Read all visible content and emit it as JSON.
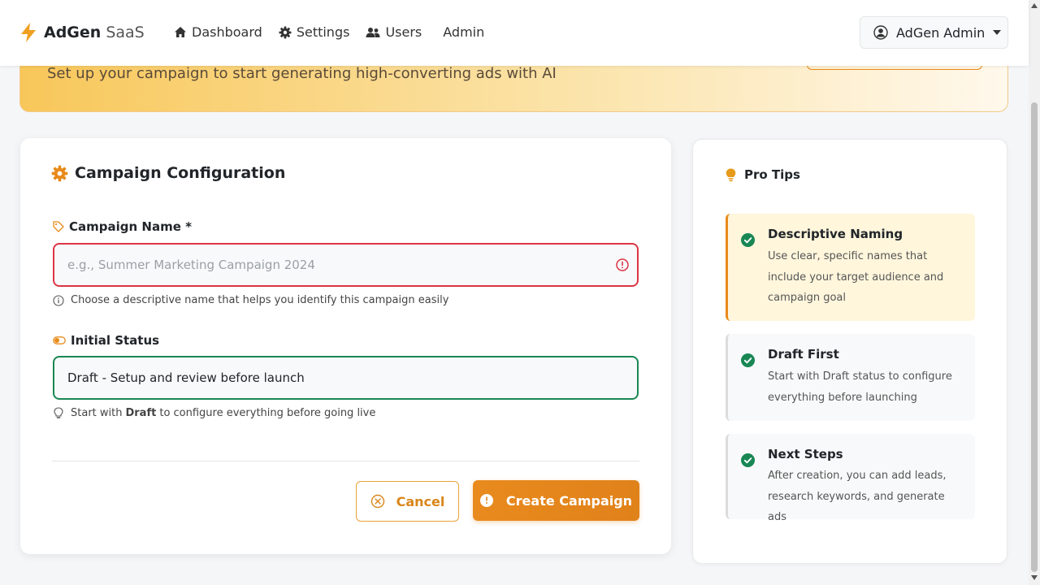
{
  "brand": {
    "main": "AdGen",
    "sub": "SaaS"
  },
  "nav": [
    {
      "label": "Dashboard",
      "icon": "home-icon"
    },
    {
      "label": "Settings",
      "icon": "gear-icon"
    },
    {
      "label": "Users",
      "icon": "users-icon"
    },
    {
      "label": "Admin",
      "icon": ""
    }
  ],
  "user": {
    "label": "AdGen Admin"
  },
  "hero": {
    "subtitle": "Set up your campaign to start generating high-converting ads with AI"
  },
  "form": {
    "title": "Campaign Configuration",
    "name_label": "Campaign Name *",
    "name_placeholder": "e.g., Summer Marketing Campaign 2024",
    "name_help": "Choose a descriptive name that helps you identify this campaign easily",
    "status_label": "Initial Status",
    "status_value": "Draft - Setup and review before launch",
    "status_help_pre": "Start with",
    "status_help_bold": "Draft",
    "status_help_post": "to configure everything before going live",
    "cancel_label": "Cancel",
    "create_label": "Create Campaign"
  },
  "tips": {
    "title": "Pro Tips",
    "items": [
      {
        "title": "Descriptive Naming",
        "text": "Use clear, specific names that include your target audience and campaign goal"
      },
      {
        "title": "Draft First",
        "text": "Start with Draft status to configure everything before launching"
      },
      {
        "title": "Next Steps",
        "text": "After creation, you can add leads, research keywords, and generate ads"
      }
    ]
  },
  "colors": {
    "accent": "#e88a1a",
    "error": "#dc3545",
    "success": "#198754",
    "tip_active_bg": "#fff6dc"
  }
}
